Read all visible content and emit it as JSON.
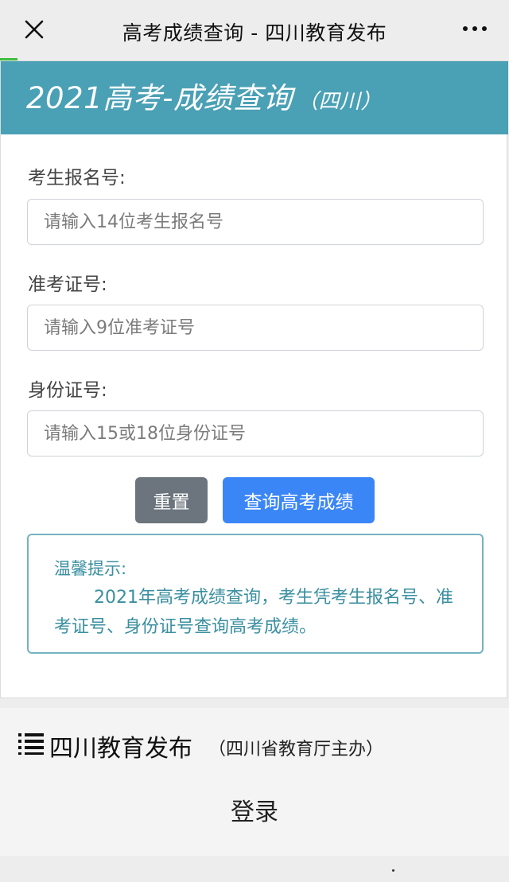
{
  "topbar": {
    "title": "高考成绩查询 - 四川教育发布"
  },
  "banner": {
    "title": "2021高考-成绩查询",
    "subtitle": "（四川）"
  },
  "form": {
    "fields": [
      {
        "label": "考生报名号:",
        "placeholder": "请输入14位考生报名号"
      },
      {
        "label": "准考证号:",
        "placeholder": "请输入9位准考证号"
      },
      {
        "label": "身份证号:",
        "placeholder": "请输入15或18位身份证号"
      }
    ],
    "reset_label": "重置",
    "query_label": "查询高考成绩"
  },
  "tip": {
    "title": "温馨提示:",
    "text": "2021年高考成绩查询，考生凭考生报名号、准考证号、身份证号查询高考成绩。"
  },
  "footer": {
    "org": "四川教育发布",
    "org_sub": "（四川省教育厅主办）",
    "login": "登录"
  },
  "colors": {
    "banner": "#4aa0b5",
    "query_button": "#3b86f7",
    "reset_button": "#6c757d",
    "tip_text": "#3a8fa0"
  }
}
